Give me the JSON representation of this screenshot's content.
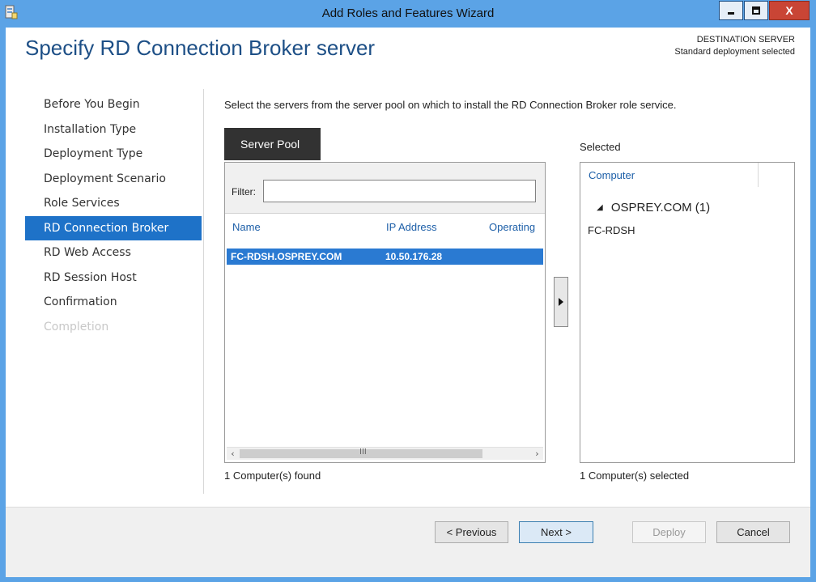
{
  "window": {
    "title": "Add Roles and Features Wizard",
    "close_label": "X"
  },
  "page": {
    "title": "Specify RD Connection Broker server",
    "destination_label": "DESTINATION SERVER",
    "destination_value": "Standard deployment selected",
    "instruction": "Select the servers from the server pool on which to install the RD Connection Broker role service."
  },
  "nav": {
    "items": [
      {
        "label": "Before You Begin",
        "state": "normal"
      },
      {
        "label": "Installation Type",
        "state": "normal"
      },
      {
        "label": "Deployment Type",
        "state": "normal"
      },
      {
        "label": "Deployment Scenario",
        "state": "normal"
      },
      {
        "label": "Role Services",
        "state": "normal"
      },
      {
        "label": "RD Connection Broker",
        "state": "active"
      },
      {
        "label": "RD Web Access",
        "state": "normal"
      },
      {
        "label": "RD Session Host",
        "state": "normal"
      },
      {
        "label": "Confirmation",
        "state": "normal"
      },
      {
        "label": "Completion",
        "state": "disabled"
      }
    ]
  },
  "pool": {
    "tab_label": "Server Pool",
    "filter_label": "Filter:",
    "filter_value": "",
    "columns": [
      "Name",
      "IP Address",
      "Operating"
    ],
    "rows": [
      {
        "name": "FC-RDSH.OSPREY.COM",
        "ip": "10.50.176.28",
        "os": ""
      }
    ],
    "scrollbar_grip": "III",
    "found_text": "1 Computer(s) found"
  },
  "selected": {
    "label": "Selected",
    "column": "Computer",
    "group": "OSPREY.COM (1)",
    "items": [
      "FC-RDSH"
    ],
    "count_text": "1 Computer(s) selected"
  },
  "footer": {
    "previous": "< Previous",
    "next": "Next >",
    "deploy": "Deploy",
    "cancel": "Cancel"
  },
  "colors": {
    "title_bar": "#5ba3e6",
    "accent": "#1e72c8",
    "selection": "#2a7ad2",
    "heading": "#1d4f86"
  }
}
